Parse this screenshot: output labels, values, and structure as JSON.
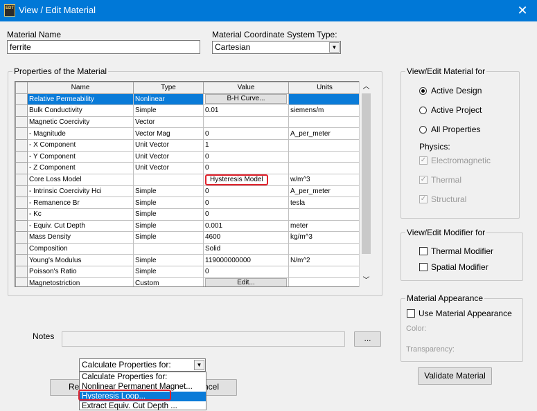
{
  "window": {
    "title": "View / Edit Material",
    "icon_text": "EDT"
  },
  "material_name": {
    "label": "Material Name",
    "value": "ferrite"
  },
  "coordinate_system": {
    "label": "Material Coordinate System Type:",
    "value": "Cartesian"
  },
  "properties": {
    "group_title": "Properties of the Material",
    "columns": [
      "Name",
      "Type",
      "Value",
      "Units"
    ],
    "rows": [
      {
        "name": "Relative Permeability",
        "type": "Nonlinear",
        "value": "B-H Curve...",
        "units": "",
        "value_is_button": true,
        "highlighted": true
      },
      {
        "name": "Bulk Conductivity",
        "type": "Simple",
        "value": "0.01",
        "units": "siemens/m"
      },
      {
        "name": "Magnetic Coercivity",
        "type": "Vector",
        "value": "",
        "units": ""
      },
      {
        "name": "- Magnitude",
        "type": "Vector Mag",
        "value": "0",
        "units": "A_per_meter"
      },
      {
        "name": "- X Component",
        "type": "Unit Vector",
        "value": "1",
        "units": ""
      },
      {
        "name": "- Y Component",
        "type": "Unit Vector",
        "value": "0",
        "units": ""
      },
      {
        "name": "- Z Component",
        "type": "Unit Vector",
        "value": "0",
        "units": ""
      },
      {
        "name": "Core Loss Model",
        "type": "",
        "value": "Hysteresis Model",
        "units": "w/m^3",
        "value_marked": true
      },
      {
        "name": "- Intrinsic Coercivity Hci",
        "type": "Simple",
        "value": "0",
        "units": "A_per_meter"
      },
      {
        "name": "- Remanence Br",
        "type": "Simple",
        "value": "0",
        "units": "tesla"
      },
      {
        "name": "- Kc",
        "type": "Simple",
        "value": "0",
        "units": ""
      },
      {
        "name": "- Equiv. Cut Depth",
        "type": "Simple",
        "value": "0.001",
        "units": "meter"
      },
      {
        "name": "Mass Density",
        "type": "Simple",
        "value": "4600",
        "units": "kg/m^3"
      },
      {
        "name": "Composition",
        "type": "",
        "value": "Solid",
        "units": ""
      },
      {
        "name": "Young's Modulus",
        "type": "Simple",
        "value": "119000000000",
        "units": "N/m^2"
      },
      {
        "name": "Poisson's Ratio",
        "type": "Simple",
        "value": "0",
        "units": ""
      },
      {
        "name": "Magnetostriction",
        "type": "Custom",
        "value": "Edit...",
        "units": "",
        "value_is_button": true
      }
    ]
  },
  "view_edit_for": {
    "group_title": "View/Edit Material for",
    "options": [
      {
        "label": "Active Design",
        "selected": true
      },
      {
        "label": "Active Project",
        "selected": false
      },
      {
        "label": "All Properties",
        "selected": false
      }
    ],
    "physics_label": "Physics:",
    "physics": [
      {
        "label": "Electromagnetic",
        "checked": true
      },
      {
        "label": "Thermal",
        "checked": true
      },
      {
        "label": "Structural",
        "checked": true
      }
    ]
  },
  "modifier_for": {
    "group_title": "View/Edit Modifier for",
    "options": [
      {
        "label": "Thermal Modifier",
        "checked": false
      },
      {
        "label": "Spatial Modifier",
        "checked": false
      }
    ]
  },
  "appearance": {
    "group_title": "Material Appearance",
    "use_label": "Use Material Appearance",
    "color_label": "Color:",
    "transparency_label": "Transparency:"
  },
  "notes": {
    "label": "Notes",
    "value": "",
    "button_label": "..."
  },
  "validate_button": "Validate Material",
  "calculate": {
    "value": "Calculate Properties for:",
    "options": [
      "Calculate Properties for:",
      "Nonlinear Permanent Magnet...",
      "Hysteresis Loop...",
      "Extract Equiv. Cut Depth ..."
    ],
    "active_index": 2
  },
  "bottom_buttons": {
    "left_partial": "Re",
    "right_partial": "ncel"
  }
}
